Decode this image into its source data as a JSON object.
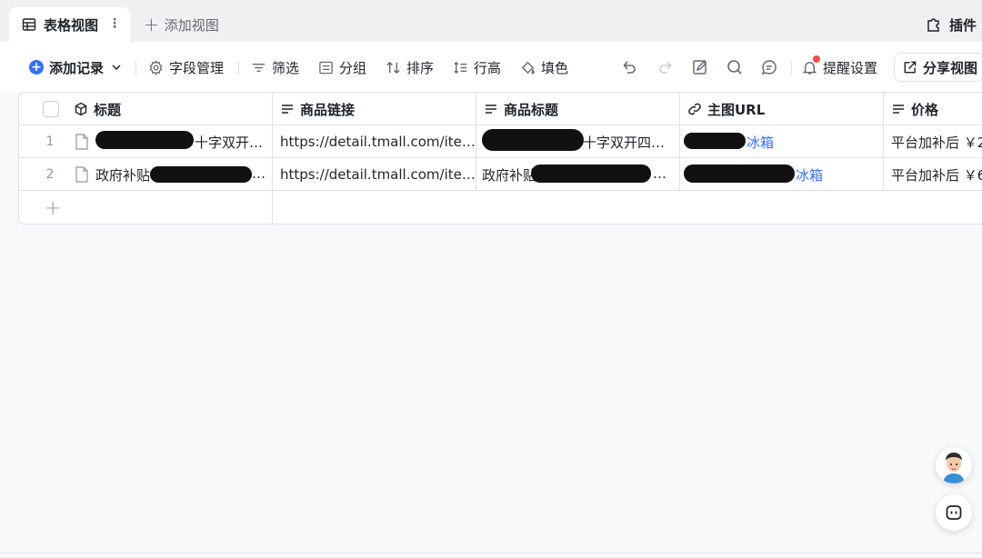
{
  "tabs": {
    "active_label": "表格视图",
    "add_view_label": "添加视图",
    "plugins_label": "插件"
  },
  "toolbar": {
    "add_record": "添加记录",
    "field_manage": "字段管理",
    "filter": "筛选",
    "group": "分组",
    "sort": "排序",
    "row_height": "行高",
    "fill_color": "填色",
    "reminder": "提醒设置",
    "share_view": "分享视图"
  },
  "table": {
    "columns": [
      {
        "label": "标题",
        "icon": "title-field-icon"
      },
      {
        "label": "商品链接",
        "icon": "text-field-icon"
      },
      {
        "label": "商品标题",
        "icon": "text-field-icon"
      },
      {
        "label": "主图URL",
        "icon": "link-field-icon"
      },
      {
        "label": "价格",
        "icon": "text-field-icon"
      }
    ],
    "rows": [
      {
        "num": "1",
        "title": "十字双开…",
        "link": "https://detail.tmall.com/ite…",
        "product_title": "十字双开四…",
        "image_url": "冰箱",
        "price": "平台加补后 ￥2"
      },
      {
        "num": "2",
        "title": "政府补贴",
        "link": "https://detail.tmall.com/ite…",
        "product_title": "政府补贴",
        "image_url": "冰箱",
        "price": "平台加补后 ￥6"
      }
    ]
  },
  "colors": {
    "accent": "#3370ff",
    "notification_dot": "#f54a45",
    "border": "#dee0e3"
  }
}
